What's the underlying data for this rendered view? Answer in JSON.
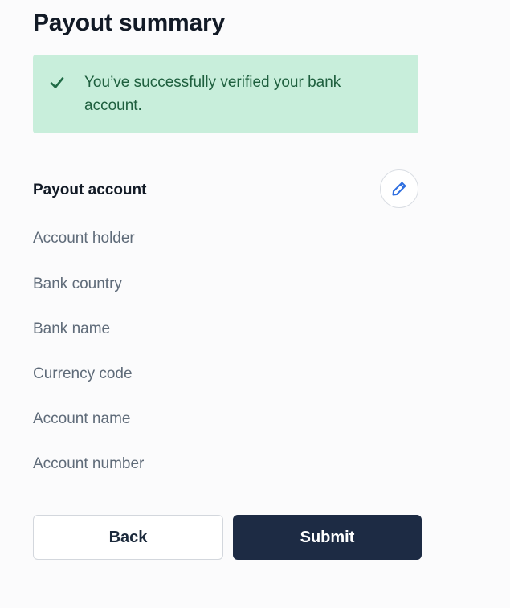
{
  "page": {
    "title": "Payout summary"
  },
  "alert": {
    "icon": "checkmark-icon",
    "message": "You’ve successfully verified your bank account.",
    "colors": {
      "background": "#c8eedb",
      "text": "#1e5f3e"
    }
  },
  "payout_account": {
    "heading": "Payout account",
    "edit_icon": "pencil-icon",
    "fields": [
      {
        "label": "Account holder",
        "value": ""
      },
      {
        "label": "Bank country",
        "value": ""
      },
      {
        "label": "Bank name",
        "value": ""
      },
      {
        "label": "Currency code",
        "value": ""
      },
      {
        "label": "Account name",
        "value": ""
      },
      {
        "label": "Account number",
        "value": ""
      }
    ]
  },
  "actions": {
    "back_label": "Back",
    "submit_label": "Submit",
    "colors": {
      "submit_background": "#1d2b44",
      "accent": "#2f6fe0"
    }
  }
}
